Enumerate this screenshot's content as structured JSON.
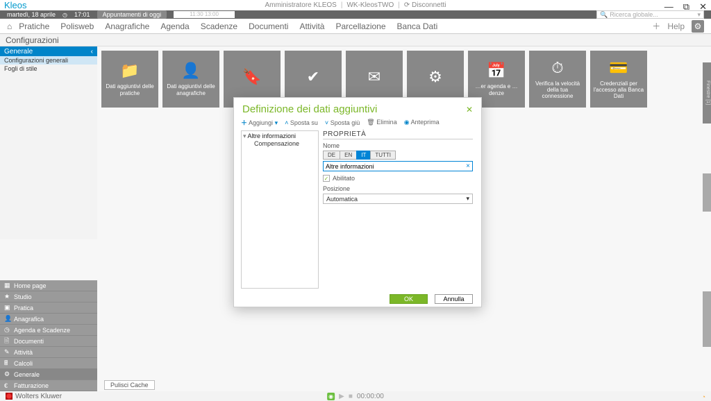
{
  "app": {
    "name": "Kleos"
  },
  "title": {
    "admin": "Amministratore KLEOS",
    "tenant": "WK-KleosTWO",
    "logout": "Disconnetti"
  },
  "datebar": {
    "date": "martedì, 18 aprile",
    "time": "17:01",
    "btn": "Appuntamenti di oggi",
    "slot": "11:30 13:00"
  },
  "search": {
    "placeholder": "Ricerca globale..."
  },
  "menu": {
    "items": [
      "Pratiche",
      "Polisweb",
      "Anagrafiche",
      "Agenda",
      "Scadenze",
      "Documenti",
      "Attività",
      "Parcellazione",
      "Banca Dati"
    ],
    "help": "Help"
  },
  "section": "Configurazioni",
  "generale": {
    "title": "Generale",
    "items": [
      "Configurazioni generali",
      "Fogli di stile"
    ]
  },
  "bottomnav": [
    "Home page",
    "Studio",
    "Pratica",
    "Anagrafica",
    "Agenda e Scadenze",
    "Documenti",
    "Attività",
    "Calcoli",
    "Generale",
    "Fatturazione"
  ],
  "tiles": [
    {
      "label": "Dati aggiuntivi delle pratiche",
      "ico": "📁"
    },
    {
      "label": "Dati aggiuntivi delle anagrafiche",
      "ico": "👤"
    },
    {
      "label": "",
      "ico": "🔖"
    },
    {
      "label": "",
      "ico": "✔"
    },
    {
      "label": "",
      "ico": "✉"
    },
    {
      "label": "",
      "ico": "⚙"
    },
    {
      "label": "…er agenda e …denze",
      "ico": "📅"
    },
    {
      "label": "Verifica la velocità della tua connessione",
      "ico": "⏱"
    },
    {
      "label": "Credenziali per l'accesso alla Banca Dati",
      "ico": "💳"
    }
  ],
  "dialog": {
    "title": "Definizione dei dati aggiuntivi",
    "toolbar": {
      "add": "Aggiungi",
      "up": "Sposta su",
      "down": "Sposta giù",
      "del": "Elimina",
      "preview": "Anteprima"
    },
    "tree": {
      "root": "Altre informazioni",
      "child": "Compensazione"
    },
    "prop": {
      "title": "PROPRIETÀ",
      "name_lbl": "Nome",
      "langs": [
        "DE",
        "EN",
        "IT",
        "TUTTI"
      ],
      "active_lang": "IT",
      "name_value": "Altre informazioni",
      "enabled_lbl": "Abilitato",
      "enabled": true,
      "pos_lbl": "Posizione",
      "pos_value": "Automatica"
    },
    "ok": "OK",
    "cancel": "Annulla"
  },
  "cache": "Pulisci Cache",
  "footer": {
    "brand": "Wolters Kluwer",
    "time": "00:00:00"
  },
  "sidetabs": [
    "Finestre [1]",
    "",
    ""
  ]
}
